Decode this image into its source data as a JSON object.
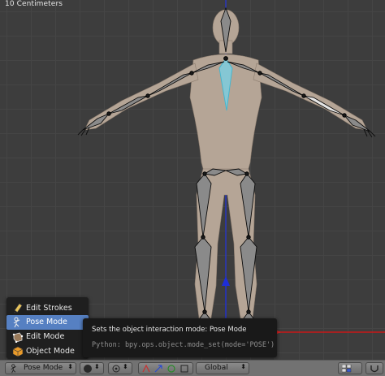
{
  "viewport": {
    "scale_label": "10 Centimeters"
  },
  "mode_menu": {
    "items": [
      {
        "label": "Edit Strokes",
        "icon": "pencil-icon"
      },
      {
        "label": "Pose Mode",
        "icon": "pose-icon",
        "active": true
      },
      {
        "label": "Edit Mode",
        "icon": "edit-mesh-icon"
      },
      {
        "label": "Object Mode",
        "icon": "object-cube-icon"
      }
    ]
  },
  "tooltip": {
    "description": "Sets the object interaction mode:",
    "value": "Pose Mode",
    "python": "Python: bpy.ops.object.mode_set(mode='POSE')"
  },
  "header": {
    "mode_label": "Pose Mode",
    "orientation_label": "Global"
  },
  "colors": {
    "viewport_bg": "#3d3d3d",
    "menu_active": "#5680c2",
    "bone_selected": "#7fd4e6",
    "axis_red": "#e02020",
    "axis_blue": "#1e2ed8"
  }
}
